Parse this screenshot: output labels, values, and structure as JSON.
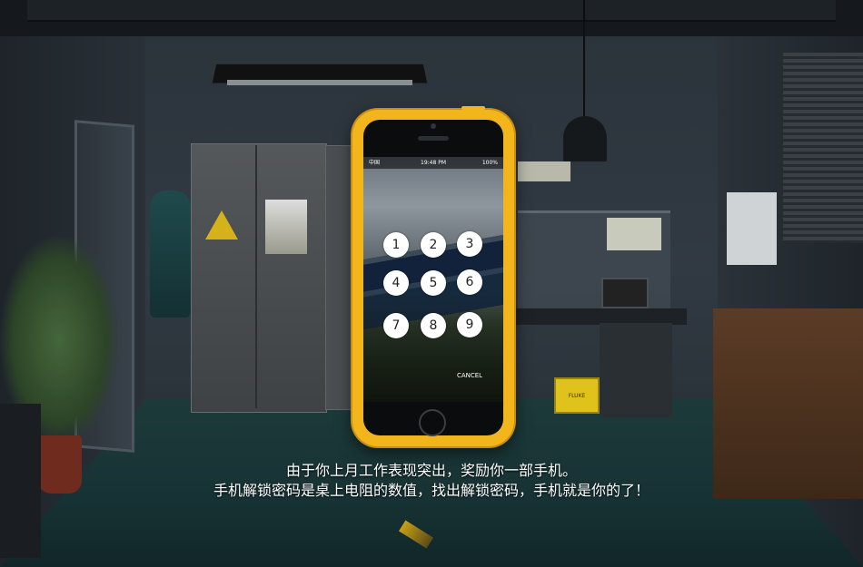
{
  "phone": {
    "status": {
      "carrier": "中国",
      "time": "19:48 PM",
      "battery": "100%"
    },
    "keypad": {
      "keys": [
        "1",
        "2",
        "3",
        "4",
        "5",
        "6",
        "7",
        "8",
        "9"
      ]
    },
    "cancel_label": "CANCEL"
  },
  "scene": {
    "fluke_label": "FLUKE"
  },
  "caption": {
    "line1": "由于你上月工作表现突出，奖励你一部手机。",
    "line2": "手机解锁密码是桌上电阻的数值，找出解锁密码，手机就是你的了！"
  }
}
